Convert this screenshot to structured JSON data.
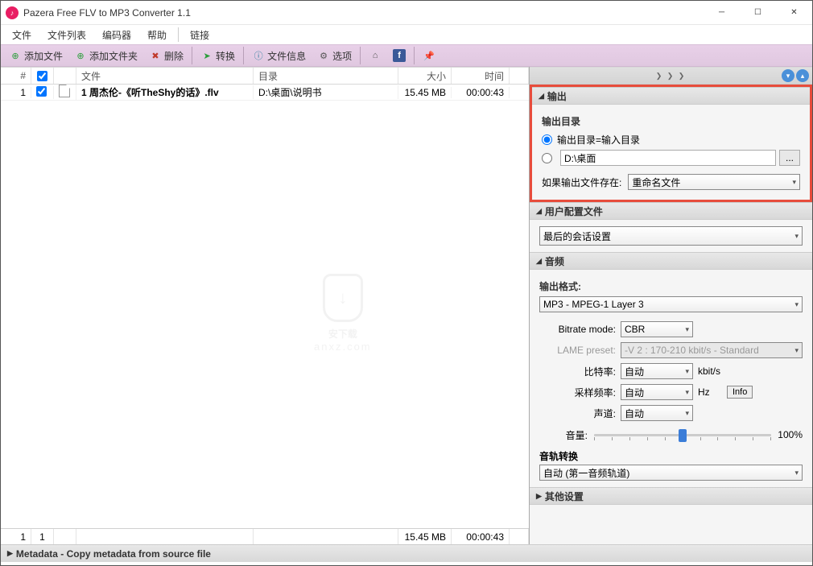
{
  "window": {
    "title": "Pazera Free FLV to MP3 Converter 1.1"
  },
  "menu": {
    "file": "文件",
    "filelist": "文件列表",
    "editor": "编码器",
    "help": "帮助",
    "link": "链接"
  },
  "toolbar": {
    "add_file": "添加文件",
    "add_folder": "添加文件夹",
    "delete": "删除",
    "convert": "转换",
    "file_info": "文件信息",
    "options": "选项"
  },
  "grid": {
    "headers": {
      "num": "#",
      "file": "文件",
      "dir": "目录",
      "size": "大小",
      "time": "时间"
    },
    "rows": [
      {
        "num": "1",
        "file": "1 周杰伦-《听TheShy的话》.flv",
        "dir": "D:\\桌面\\说明书",
        "size": "15.45 MB",
        "time": "00:00:43"
      }
    ],
    "footer": {
      "count1": "1",
      "count2": "1",
      "size": "15.45 MB",
      "time": "00:00:43"
    }
  },
  "right_head": {
    "expand": "❯ ❯ ❯"
  },
  "sections": {
    "output": "输出",
    "user_profile": "用户配置文件",
    "audio": "音频",
    "other": "其他设置"
  },
  "output": {
    "dir_label": "输出目录",
    "opt_same": "输出目录=输入目录",
    "opt_path": "D:\\桌面",
    "if_exists_label": "如果输出文件存在:",
    "if_exists_value": "重命名文件"
  },
  "profile": {
    "value": "最后的会话设置"
  },
  "audio": {
    "format_label": "输出格式:",
    "format_value": "MP3 - MPEG-1 Layer 3",
    "bitrate_mode_label": "Bitrate mode:",
    "bitrate_mode_value": "CBR",
    "lame_label": "LAME preset:",
    "lame_value": "-V 2 : 170-210 kbit/s - Standard",
    "bitrate_label": "比特率:",
    "bitrate_value": "自动",
    "bitrate_unit": "kbit/s",
    "sample_label": "采样频率:",
    "sample_value": "自动",
    "sample_unit": "Hz",
    "channel_label": "声道:",
    "channel_value": "自动",
    "info_btn": "Info",
    "volume_label": "音量:",
    "volume_value": "100%",
    "track_label": "音轨转换",
    "track_value": "自动 (第一音频轨道)"
  },
  "metadata": {
    "label": "Metadata - Copy metadata from source file"
  },
  "watermark": {
    "main": "安下载",
    "sub": "anxz.com"
  }
}
